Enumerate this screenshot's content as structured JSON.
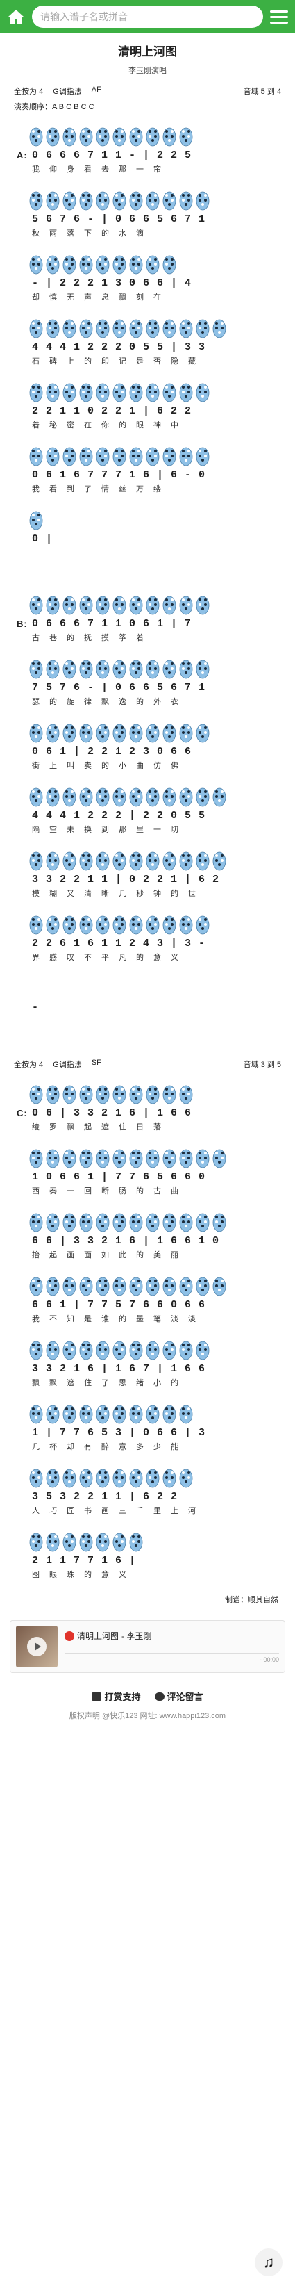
{
  "header": {
    "search_placeholder": "请输入谱子名或拼音"
  },
  "song": {
    "title": "清明上河图",
    "singer": "李玉刚演唱",
    "key_left": "全按为 4",
    "key_mid": "G调指法",
    "key_right": "AF",
    "range_label": "音域",
    "range_value": "5 到 4",
    "order": "演奏顺序：A B C B C C"
  },
  "sections": [
    {
      "label": "A:",
      "rows": [
        {
          "notes": "0 6 6 6 7 1 1 - | 2 2 5",
          "lyrics": "我仰身看去那一帘"
        },
        {
          "notes": "5 6 7 6 - | 0 6 6 5 6 7 1",
          "lyrics": "秋雨落下的水滴"
        },
        {
          "notes": "- | 2 2 2 1 3 0 6 6 | 4",
          "lyrics": "却慎无声息飘刻在"
        },
        {
          "notes": "4 4 4 1 2 2 2 0 5 5 | 3 3",
          "lyrics": "石碑上的印记是否隐藏"
        },
        {
          "notes": "2 2 1 1 0 2 2 1 | 6 2 2",
          "lyrics": "着秘密在你的眼神中"
        },
        {
          "notes": "0 6 1 6 7 7 7 1 6 | 6 - 0",
          "lyrics": "我看到了情丝万缕"
        },
        {
          "notes": "0 |",
          "lyrics": ""
        }
      ]
    },
    {
      "label": "B:",
      "rows": [
        {
          "notes": "0 6 6 6 7 1 1 0 6 1 | 7",
          "lyrics": "古巷的抚摸筝着"
        },
        {
          "notes": "7 5 7 6 - | 0 6 6 5 6 7 1",
          "lyrics": "瑟的旋律飘逸的外衣"
        },
        {
          "notes": "0 6 1 | 2 2 1 2 3 0 6 6",
          "lyrics": "街上叫卖的小曲仿佛"
        },
        {
          "notes": "4 4 4 1 2 2 2 | 2 2 0 5 5",
          "lyrics": "隔空未换到那里一切"
        },
        {
          "notes": "3 3 2 2 1 1 | 0 2 2 1 | 6 2",
          "lyrics": "模糊又清晰几秒钟的世"
        },
        {
          "notes": "2 2 6 1 6 1 1 2 4 3 | 3 -",
          "lyrics": "界感叹不平凡的意义"
        },
        {
          "notes": "-",
          "lyrics": ""
        }
      ]
    }
  ],
  "section_c_meta": {
    "key_left": "全按为 4",
    "key_mid": "G调指法",
    "key_right": "SF",
    "range_label": "音域",
    "range_value": "3 到 5"
  },
  "section_c": {
    "label": "C:",
    "rows": [
      {
        "notes": "0 6 | 3 3 2 1 6 | 1 6 6",
        "lyrics": "绫罗飘起遮住日落"
      },
      {
        "notes": "1 0 6 6 1 | 7 7 6 5 6 6 0",
        "lyrics": "西奏一回断肠的古曲"
      },
      {
        "notes": "6 6 | 3 3 2 1 6 | 1 6 6 1 0",
        "lyrics": "抬起画面如此的美丽"
      },
      {
        "notes": "6 6 1 | 7 7 5 7 6 6 0 6 6",
        "lyrics": "我不知是谁的墨笔淡淡"
      },
      {
        "notes": "3 3 2 1 6 | 1 6 7 | 1 6 6",
        "lyrics": "飘飘遮住了思绪小的"
      },
      {
        "notes": "1 | 7 7 6 5 3 | 0 6 6 | 3",
        "lyrics": "几杯却有醉意多少能"
      },
      {
        "notes": "3 5 3 2 2 1 1 | 6 2 2",
        "lyrics": "人巧匠书画三千里上河"
      },
      {
        "notes": "2 1 1 7 7 1 6 |",
        "lyrics": "图眼珠的意义"
      }
    ]
  },
  "credit": "制谱：顺其自然",
  "player": {
    "title": "清明上河图",
    "artist": "- 李玉刚",
    "time": "- 00:00"
  },
  "support": {
    "donate": "打赏支持",
    "comment": "评论留言"
  },
  "footer": "版权声明    @快乐123 网址: www.happi123.com",
  "colors": {
    "topbar": "#3cb043",
    "ocarina": "#8ec0e6"
  }
}
